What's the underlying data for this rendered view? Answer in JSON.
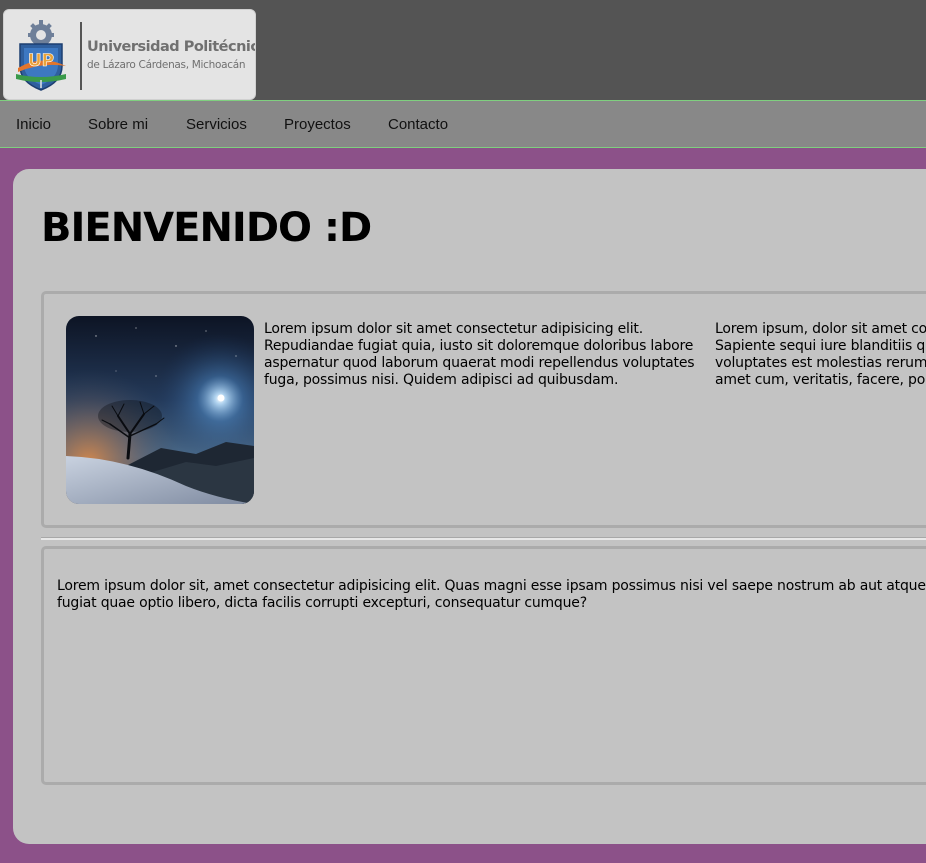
{
  "header": {
    "logo": {
      "emblem_text": "UP",
      "title": "Universidad Politécnica",
      "subtitle": "de Lázaro Cárdenas, Michoacán"
    }
  },
  "nav": {
    "items": [
      {
        "label": "Inicio"
      },
      {
        "label": "Sobre mi"
      },
      {
        "label": "Servicios"
      },
      {
        "label": "Proyectos"
      },
      {
        "label": "Contacto"
      }
    ]
  },
  "main": {
    "title": "BIENVENIDO :D",
    "section_one": {
      "image_icon": "night-landscape-image",
      "column_one_text": "Lorem ipsum dolor sit amet consectetur adipisicing elit. Repudiandae fugiat quia, iusto sit doloremque doloribus labore aspernatur quod laborum quaerat modi repellendus voluptates fuga, possimus nisi. Quidem adipisci ad quibusdam.",
      "column_two_lines": [
        "Lorem ipsum, dolor sit amet co",
        "Sapiente sequi iure blanditiis qu",
        "voluptates est molestias rerum",
        "amet cum, veritatis, facere, po"
      ]
    },
    "section_two": {
      "text": "Lorem ipsum dolor sit, amet consectetur adipisicing elit. Quas magni esse ipsam possimus nisi vel saepe nostrum ab aut atque fugiat quae optio libero, dicta facilis corrupti excepturi, consequatur cumque?"
    }
  },
  "colors": {
    "page_background": "#8c5189",
    "top_bar": "#545454",
    "nav_bar": "#888888",
    "nav_border": "#7fcf7f",
    "card": "#c3c3c3",
    "section_border": "#ababab"
  }
}
